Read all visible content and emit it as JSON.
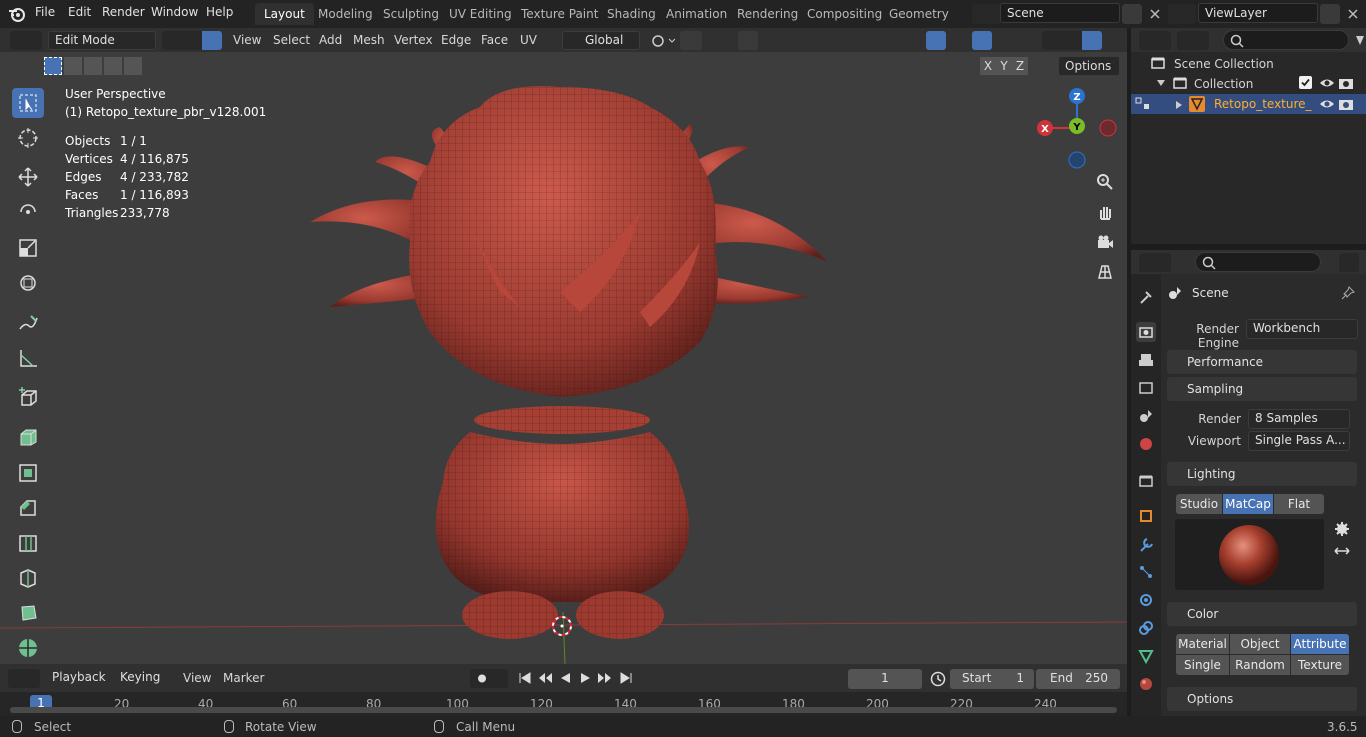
{
  "menu": {
    "file": "File",
    "edit": "Edit",
    "render": "Render",
    "window": "Window",
    "help": "Help"
  },
  "workspaces": [
    "Layout",
    "Modeling",
    "Sculpting",
    "UV Editing",
    "Texture Paint",
    "Shading",
    "Animation",
    "Rendering",
    "Compositing",
    "Geometry Noc"
  ],
  "scene": "Scene",
  "view_layer": "ViewLayer",
  "viewport_header": {
    "mode": "Edit Mode",
    "view": "View",
    "select": "Select",
    "add": "Add",
    "mesh": "Mesh",
    "vertex": "Vertex",
    "edge": "Edge",
    "face": "Face",
    "uv": "UV",
    "orientation": "Global",
    "options": "Options",
    "x": "X",
    "y": "Y",
    "z": "Z"
  },
  "overlay_info": {
    "perspective": "User Perspective",
    "object_name": "(1) Retopo_texture_pbr_v128.001",
    "rows": [
      {
        "label": "Objects",
        "value": "1 / 1"
      },
      {
        "label": "Vertices",
        "value": "4 / 116,875"
      },
      {
        "label": "Edges",
        "value": "4 / 233,782"
      },
      {
        "label": "Faces",
        "value": "1 / 116,893"
      },
      {
        "label": "Triangles",
        "value": "233,778"
      }
    ]
  },
  "gizmo": {
    "x": "X",
    "y": "Y",
    "z": "Z"
  },
  "outliner": {
    "scene_collection": "Scene Collection",
    "collection": "Collection",
    "object": "Retopo_texture_"
  },
  "properties": {
    "title": "Scene",
    "render_engine_label": "Render Engine",
    "render_engine": "Workbench",
    "performance": "Performance",
    "sampling": "Sampling",
    "render_label": "Render",
    "render_value": "8 Samples",
    "viewport_label": "Viewport",
    "viewport_value": "Single Pass A...",
    "lighting": "Lighting",
    "lighting_modes": [
      "Studio",
      "MatCap",
      "Flat"
    ],
    "color": "Color",
    "color_modes": [
      "Material",
      "Object",
      "Attribute",
      "Single",
      "Random",
      "Texture"
    ],
    "options": "Options"
  },
  "timeline": {
    "playback": "Playback",
    "keying": "Keying",
    "view": "View",
    "marker": "Marker",
    "current_frame": "1",
    "start_label": "Start",
    "start": "1",
    "end_label": "End",
    "end": "250",
    "ticks": [
      "1",
      "20",
      "40",
      "60",
      "80",
      "100",
      "120",
      "140",
      "160",
      "180",
      "200",
      "220",
      "240"
    ]
  },
  "statusbar": {
    "select": "Select",
    "rotate": "Rotate View",
    "call_menu": "Call Menu",
    "version": "3.6.5"
  },
  "colors": {
    "accent": "#4772b3",
    "mesh": "#b5483d",
    "x_axis": "#d0333a",
    "y_axis": "#7bbd27",
    "z_axis": "#2a73d0"
  }
}
